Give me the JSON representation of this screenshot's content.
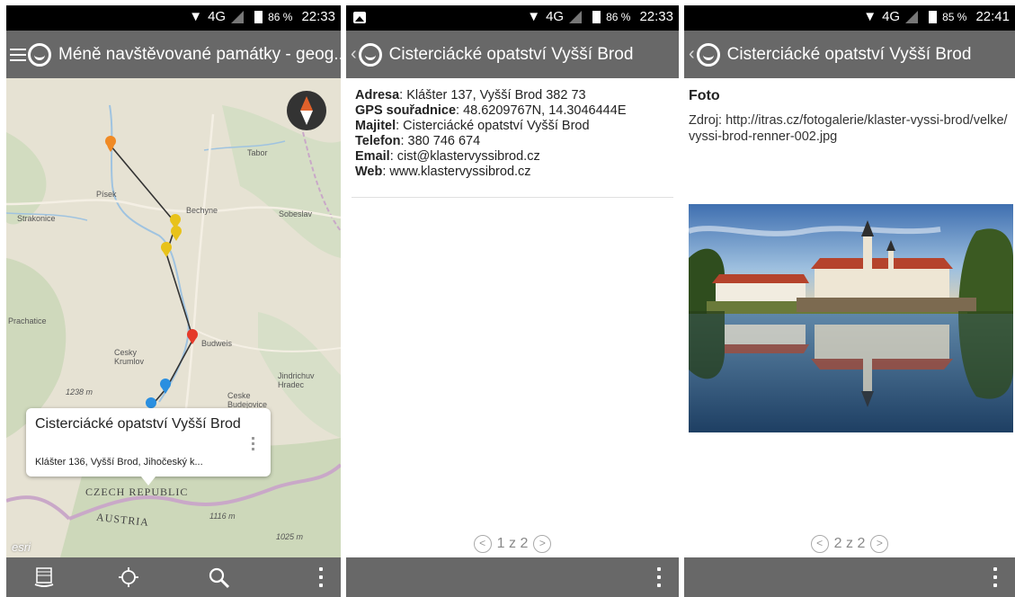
{
  "status1": {
    "network": "4G",
    "battery": "86 %",
    "time": "22:33"
  },
  "status2": {
    "network": "4G",
    "battery": "86 %",
    "time": "22:33"
  },
  "status3": {
    "network": "4G",
    "battery": "85 %",
    "time": "22:41"
  },
  "screen1": {
    "title": "Méně navštěvované památky - geog...",
    "map_labels": [
      "Tabor",
      "Písek",
      "Bechyne",
      "Sobeslav",
      "Strakonice",
      "Budweis",
      "Prachatice",
      "Cesky Krumlov",
      "Jindrichuv Hradec",
      "Ceske Budejovice",
      "1238 m",
      "1116 m",
      "1025 m",
      "CZECH REPUBLIC",
      "AUSTRIA"
    ],
    "esri": "esri",
    "popup": {
      "title": "Cisterciácké opatství Vyšší Brod",
      "subtitle": "Klášter 136, Vyšší Brod, Jihočeský k..."
    },
    "bottom_icons": [
      "layers-icon",
      "locate-icon",
      "search-icon",
      "more-icon"
    ]
  },
  "screen2": {
    "title": "Cisterciácké opatství Vyšší Brod",
    "fields": [
      {
        "label": "Adresa",
        "value": ": Klášter 137, Vyšší Brod 382 73"
      },
      {
        "label": "GPS souřadnice",
        "value": ": 48.6209767N, 14.3046444E"
      },
      {
        "label": "Majitel",
        "value": ": Cisterciácké opatství Vyšší Brod"
      },
      {
        "label": "Telefon",
        "value": ": 380 746 674"
      },
      {
        "label": "Email",
        "value": ": cist@klastervyssibrod.cz"
      },
      {
        "label": "Web",
        "value": ": www.klastervyssibrod.cz"
      }
    ],
    "pager": "1 z 2"
  },
  "screen3": {
    "title": "Cisterciácké opatství Vyšší Brod",
    "heading": "Foto",
    "source": "Zdroj: http://itras.cz/fotogalerie/klaster-vyssi-brod/velke/vyssi-brod-renner-002.jpg",
    "pager": "2 z 2"
  },
  "colors": {
    "appbar": "#686868",
    "status": "#000000",
    "pin_orange": "#f08a24",
    "pin_yellow": "#e8c21a",
    "pin_red": "#e53a2a",
    "pin_blue": "#2a8fe0"
  }
}
